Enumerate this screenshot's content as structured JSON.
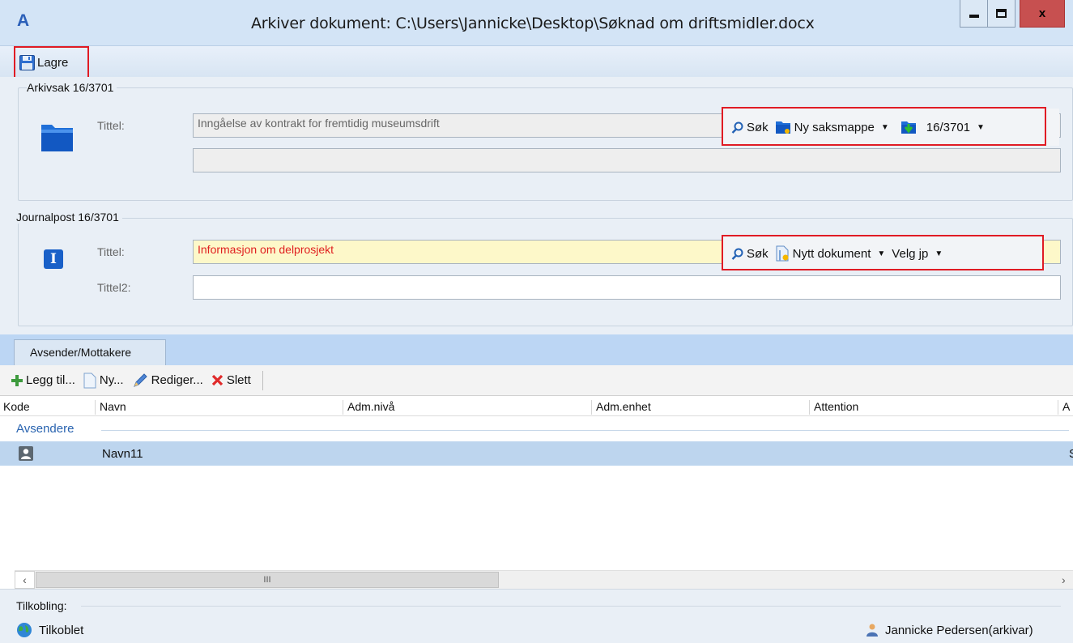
{
  "window": {
    "title": "Arkiver dokument: C:\\Users\\Jannicke\\Desktop\\Søknad om driftsmidler.docx",
    "app_icon_letter": "A",
    "close_label": "x"
  },
  "toolbar": {
    "save_label": "Lagre"
  },
  "arkivsak": {
    "group_label": "Arkivsak 16/3701",
    "title_label": "Tittel:",
    "title_value": "Inngåelse av kontrakt for fremtidig museumsdrift",
    "second_value": "",
    "search_label": "Søk",
    "new_folder_label": "Ny saksmappe",
    "case_number_label": "16/3701"
  },
  "journalpost": {
    "group_label": "Journalpost 16/3701",
    "title_label": "Tittel:",
    "title_value": "Informasjon om delprosjekt",
    "title2_label": "Tittel2:",
    "title2_value": "",
    "icon_letter": "I",
    "search_label": "Søk",
    "new_document_label": "Nytt dokument",
    "choose_jp_label": "Velg jp"
  },
  "tabs": [
    {
      "label": "Avsender/Mottakere",
      "active": true
    }
  ],
  "list_toolbar": {
    "add_label": "Legg til...",
    "new_label": "Ny...",
    "edit_label": "Rediger...",
    "delete_label": "Slett"
  },
  "table": {
    "columns": [
      "Kode",
      "Navn",
      "Adm.nivå",
      "Adm.enhet",
      "Attention",
      "A"
    ],
    "groups": [
      {
        "label": "Avsendere",
        "rows": [
          {
            "kode": "",
            "navn": "Navn11",
            "trailing": "S",
            "selected": true
          }
        ]
      }
    ]
  },
  "scrollbar": {
    "thumb_grip": "III"
  },
  "status": {
    "caption": "Tilkobling:",
    "connection": "Tilkoblet",
    "user": "Jannicke Pedersen(arkivar)"
  },
  "colors": {
    "titlebar": "#d3e4f6",
    "close_button": "#c75050",
    "highlight_box": "#e01b24",
    "required_field": "#fdf8c9",
    "required_text": "#e02020",
    "selected_row": "#bdd5ee",
    "group_text": "#2a64b0"
  }
}
